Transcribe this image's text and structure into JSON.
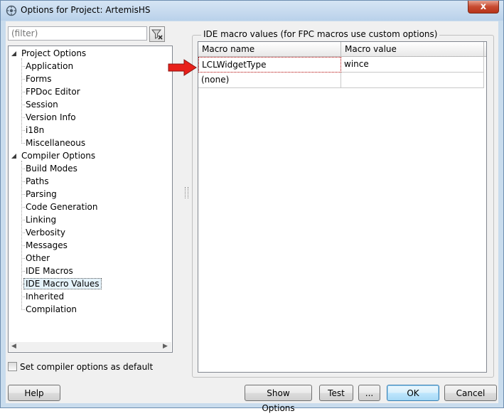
{
  "window": {
    "title": "Options for Project: ArtemisHS",
    "close_glyph": "x"
  },
  "filter": {
    "placeholder": "(filter)"
  },
  "tree": {
    "groups": [
      {
        "label": "Project Options",
        "items": [
          "Application",
          "Forms",
          "FPDoc Editor",
          "Session",
          "Version Info",
          "i18n",
          "Miscellaneous"
        ]
      },
      {
        "label": "Compiler Options",
        "items": [
          "Build Modes",
          "Paths",
          "Parsing",
          "Code Generation",
          "Linking",
          "Verbosity",
          "Messages",
          "Other",
          "IDE Macros",
          "IDE Macro Values",
          "Inherited",
          "Compilation"
        ]
      }
    ],
    "selected": "IDE Macro Values"
  },
  "default_checkbox": {
    "label": "Set compiler options as default",
    "checked": false
  },
  "macro_panel": {
    "title": "IDE macro values (for FPC macros use custom options)",
    "columns": [
      "Macro name",
      "Macro value"
    ],
    "rows": [
      [
        "LCLWidgetType",
        "wince"
      ],
      [
        "(none)",
        ""
      ]
    ]
  },
  "buttons": {
    "help": "Help",
    "show_options": "Show Options",
    "test": "Test",
    "more": "...",
    "ok": "OK",
    "cancel": "Cancel"
  },
  "colors": {
    "arrow": "#e8201a",
    "selection_bg": "#e5f3fb"
  }
}
